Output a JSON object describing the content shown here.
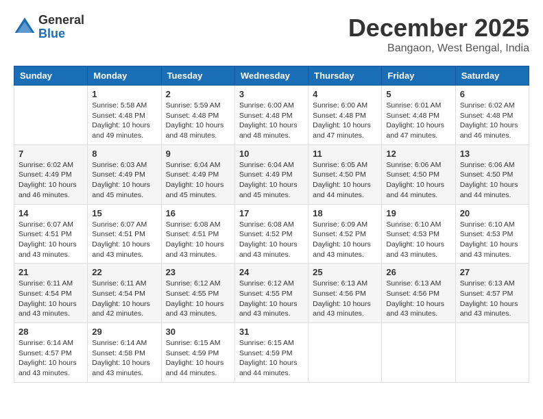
{
  "header": {
    "logo_general": "General",
    "logo_blue": "Blue",
    "month_title": "December 2025",
    "location": "Bangaon, West Bengal, India"
  },
  "days_of_week": [
    "Sunday",
    "Monday",
    "Tuesday",
    "Wednesday",
    "Thursday",
    "Friday",
    "Saturday"
  ],
  "weeks": [
    [
      {
        "day": "",
        "info": ""
      },
      {
        "day": "1",
        "info": "Sunrise: 5:58 AM\nSunset: 4:48 PM\nDaylight: 10 hours\nand 49 minutes."
      },
      {
        "day": "2",
        "info": "Sunrise: 5:59 AM\nSunset: 4:48 PM\nDaylight: 10 hours\nand 48 minutes."
      },
      {
        "day": "3",
        "info": "Sunrise: 6:00 AM\nSunset: 4:48 PM\nDaylight: 10 hours\nand 48 minutes."
      },
      {
        "day": "4",
        "info": "Sunrise: 6:00 AM\nSunset: 4:48 PM\nDaylight: 10 hours\nand 47 minutes."
      },
      {
        "day": "5",
        "info": "Sunrise: 6:01 AM\nSunset: 4:48 PM\nDaylight: 10 hours\nand 47 minutes."
      },
      {
        "day": "6",
        "info": "Sunrise: 6:02 AM\nSunset: 4:48 PM\nDaylight: 10 hours\nand 46 minutes."
      }
    ],
    [
      {
        "day": "7",
        "info": "Sunrise: 6:02 AM\nSunset: 4:49 PM\nDaylight: 10 hours\nand 46 minutes."
      },
      {
        "day": "8",
        "info": "Sunrise: 6:03 AM\nSunset: 4:49 PM\nDaylight: 10 hours\nand 45 minutes."
      },
      {
        "day": "9",
        "info": "Sunrise: 6:04 AM\nSunset: 4:49 PM\nDaylight: 10 hours\nand 45 minutes."
      },
      {
        "day": "10",
        "info": "Sunrise: 6:04 AM\nSunset: 4:49 PM\nDaylight: 10 hours\nand 45 minutes."
      },
      {
        "day": "11",
        "info": "Sunrise: 6:05 AM\nSunset: 4:50 PM\nDaylight: 10 hours\nand 44 minutes."
      },
      {
        "day": "12",
        "info": "Sunrise: 6:06 AM\nSunset: 4:50 PM\nDaylight: 10 hours\nand 44 minutes."
      },
      {
        "day": "13",
        "info": "Sunrise: 6:06 AM\nSunset: 4:50 PM\nDaylight: 10 hours\nand 44 minutes."
      }
    ],
    [
      {
        "day": "14",
        "info": "Sunrise: 6:07 AM\nSunset: 4:51 PM\nDaylight: 10 hours\nand 43 minutes."
      },
      {
        "day": "15",
        "info": "Sunrise: 6:07 AM\nSunset: 4:51 PM\nDaylight: 10 hours\nand 43 minutes."
      },
      {
        "day": "16",
        "info": "Sunrise: 6:08 AM\nSunset: 4:51 PM\nDaylight: 10 hours\nand 43 minutes."
      },
      {
        "day": "17",
        "info": "Sunrise: 6:08 AM\nSunset: 4:52 PM\nDaylight: 10 hours\nand 43 minutes."
      },
      {
        "day": "18",
        "info": "Sunrise: 6:09 AM\nSunset: 4:52 PM\nDaylight: 10 hours\nand 43 minutes."
      },
      {
        "day": "19",
        "info": "Sunrise: 6:10 AM\nSunset: 4:53 PM\nDaylight: 10 hours\nand 43 minutes."
      },
      {
        "day": "20",
        "info": "Sunrise: 6:10 AM\nSunset: 4:53 PM\nDaylight: 10 hours\nand 43 minutes."
      }
    ],
    [
      {
        "day": "21",
        "info": "Sunrise: 6:11 AM\nSunset: 4:54 PM\nDaylight: 10 hours\nand 43 minutes."
      },
      {
        "day": "22",
        "info": "Sunrise: 6:11 AM\nSunset: 4:54 PM\nDaylight: 10 hours\nand 42 minutes."
      },
      {
        "day": "23",
        "info": "Sunrise: 6:12 AM\nSunset: 4:55 PM\nDaylight: 10 hours\nand 43 minutes."
      },
      {
        "day": "24",
        "info": "Sunrise: 6:12 AM\nSunset: 4:55 PM\nDaylight: 10 hours\nand 43 minutes."
      },
      {
        "day": "25",
        "info": "Sunrise: 6:13 AM\nSunset: 4:56 PM\nDaylight: 10 hours\nand 43 minutes."
      },
      {
        "day": "26",
        "info": "Sunrise: 6:13 AM\nSunset: 4:56 PM\nDaylight: 10 hours\nand 43 minutes."
      },
      {
        "day": "27",
        "info": "Sunrise: 6:13 AM\nSunset: 4:57 PM\nDaylight: 10 hours\nand 43 minutes."
      }
    ],
    [
      {
        "day": "28",
        "info": "Sunrise: 6:14 AM\nSunset: 4:57 PM\nDaylight: 10 hours\nand 43 minutes."
      },
      {
        "day": "29",
        "info": "Sunrise: 6:14 AM\nSunset: 4:58 PM\nDaylight: 10 hours\nand 43 minutes."
      },
      {
        "day": "30",
        "info": "Sunrise: 6:15 AM\nSunset: 4:59 PM\nDaylight: 10 hours\nand 44 minutes."
      },
      {
        "day": "31",
        "info": "Sunrise: 6:15 AM\nSunset: 4:59 PM\nDaylight: 10 hours\nand 44 minutes."
      },
      {
        "day": "",
        "info": ""
      },
      {
        "day": "",
        "info": ""
      },
      {
        "day": "",
        "info": ""
      }
    ]
  ]
}
